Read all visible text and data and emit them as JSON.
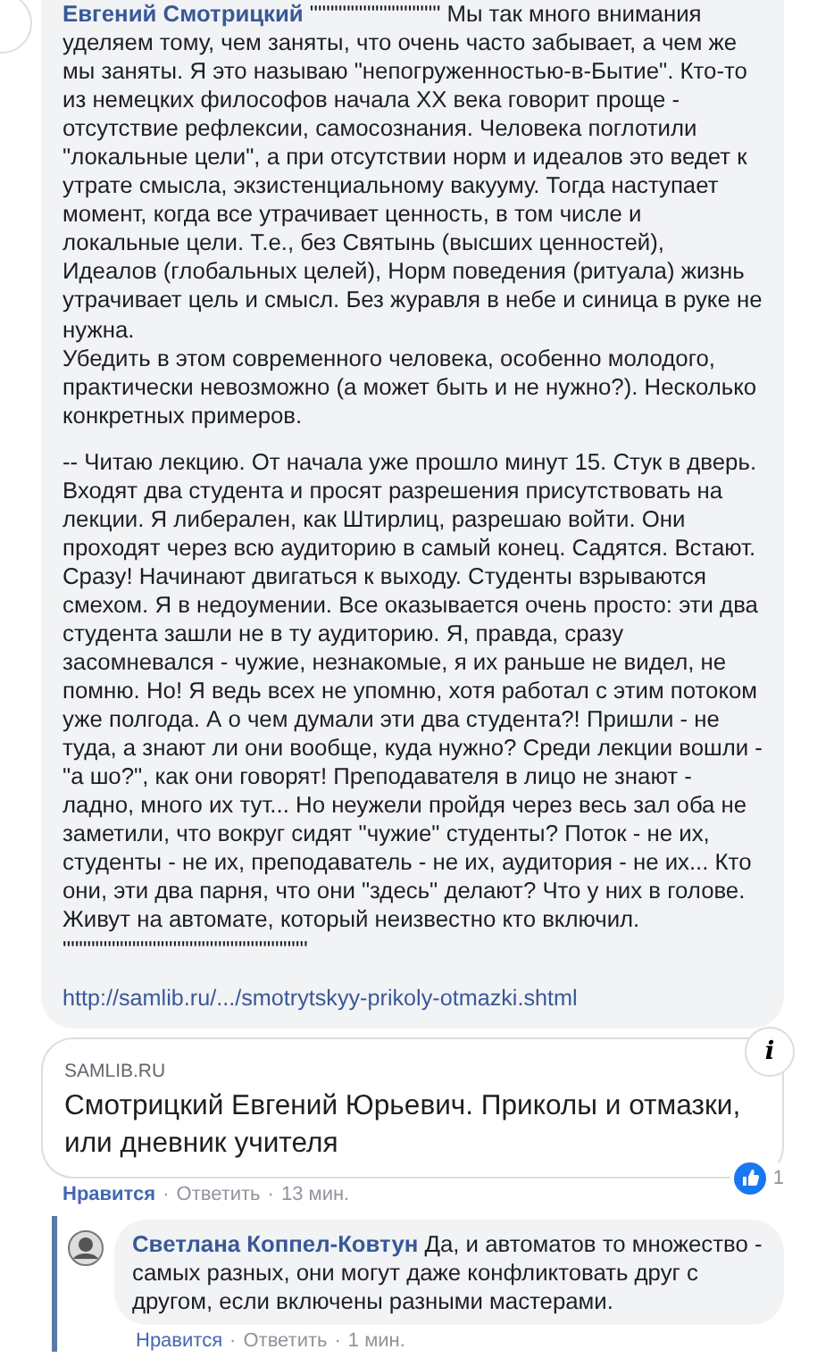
{
  "comment": {
    "author": "Евгений Смотрицкий",
    "paragraphs": [
      "\"\"\"\"\"\"\"\"\"\"\"\"\"\"\"\" Мы так много внимания уделяем тому, чем заняты, что очень часто забывает, а чем же мы заняты. Я это называю \"непогруженностью-в-Бытие\". Кто-то из немецких философов начала XX века говорит проще - отсутствие рефлексии, самосознания. Человека поглотили \"локальные цели\", а при отсутствии норм и идеалов это ведет к утрате смысла, экзистенциальному вакууму. Тогда наступает момент, когда все утрачивает ценность, в том числе и локальные цели. Т.е., без Святынь (высших ценностей), Идеалов (глобальных целей), Норм поведения (ритуала) жизнь утрачивает цель и смысл. Без журавля в небе и синица в руке не нужна.\nУбедить в этом современного человека, особенно молодого, практически невозможно (а может быть и не нужно?). Несколько конкретных примеров.",
      "-- Читаю лекцию. От начала уже прошло минут 15. Стук в дверь. Входят два студента и просят разрешения присутствовать на лекции. Я либерален, как Штирлиц, разрешаю войти. Они проходят через всю аудиторию в самый конец. Садятся. Встают. Сразу! Начинают двигаться к выходу. Студенты взрываются смехом. Я в недоумении. Все оказывается очень просто: эти два студента зашли не в ту аудиторию. Я, правда, сразу засомневался - чужие, незнакомые, я их раньше не видел, не помню. Но! Я ведь всех не упомню, хотя работал с этим потоком уже полгода. А о чем думали эти два студента?! Пришли - не туда, а знают ли они вообще, куда нужно? Среди лекции вошли - \"а шо?\", как они говорят! Преподавателя в лицо не знают - ладно, много их тут... Но неужели пройдя через весь зал оба не заметили, что вокруг сидят \"чужие\" студенты? Поток - не их, студенты - не их, преподаватель - не их, аудитория - не их... Кто они, эти два парня, что они \"здесь\" делают? Что у них в голове. Живут на автомате, который неизвестно кто включил.\n\"\"\"\"\"\"\"\"\"\"\"\"\"\"\"\"\"\"\"\"\"\"\"\"\"\"\"\"\"\""
    ],
    "link": "http://samlib.ru/.../smotrytskyy-prikoly-otmazki.shtml",
    "preview": {
      "domain": "SAMLIB.RU",
      "title": "Смотрицкий Евгений Юрьевич. Приколы и отмазки, или дневник учителя",
      "info": "i"
    },
    "reactions": {
      "count": "1"
    },
    "actions": [
      {
        "label": "Нравится",
        "liked": true
      },
      {
        "label": "Ответить"
      },
      {
        "label": "13 мин."
      }
    ],
    "separators": [
      "·",
      "·"
    ]
  },
  "reply": {
    "author": "Светлана Коппел-Ковтун",
    "text": "Да, и автоматов то множество - самых разных, они могут даже конфликтовать друг с другом, если включены разными мастерами.",
    "actions": [
      {
        "label": "Нравится",
        "liked": false
      },
      {
        "label": "Ответить"
      },
      {
        "label": "1 мин."
      }
    ],
    "separators": [
      "·",
      "·"
    ]
  }
}
